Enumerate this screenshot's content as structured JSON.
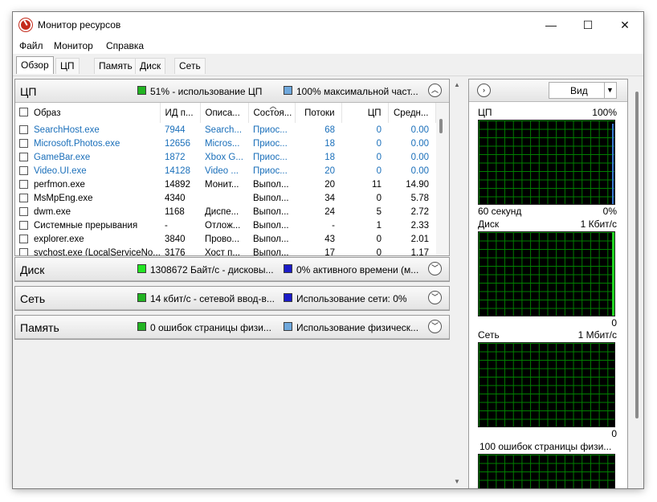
{
  "window": {
    "title": "Монитор ресурсов",
    "icon": "resmon-icon",
    "controls": {
      "minimize": "—",
      "maximize": "☐",
      "close": "✕"
    }
  },
  "menu": [
    "Файл",
    "Монитор",
    "Справка"
  ],
  "tabs": [
    {
      "label": "Обзор",
      "active": true
    },
    {
      "label": "ЦП"
    },
    {
      "label": "Память"
    },
    {
      "label": "Диск"
    },
    {
      "label": "Сеть"
    }
  ],
  "cpu": {
    "title": "ЦП",
    "legend1": {
      "color": "#22b422",
      "text": "51% - использование ЦП"
    },
    "legend2": {
      "color": "#6fa8dc",
      "text": "100% максимальной част..."
    },
    "columns": [
      "Образ",
      "ИД п...",
      "Описа...",
      "Состоя...",
      "Потоки",
      "ЦП",
      "Средн..."
    ],
    "rows": [
      {
        "name": "SearchHost.exe",
        "pid": "7944",
        "desc": "Search...",
        "status": "Приос...",
        "threads": "68",
        "cpu": "0",
        "avg": "0.00",
        "suspended": true
      },
      {
        "name": "Microsoft.Photos.exe",
        "pid": "12656",
        "desc": "Micros...",
        "status": "Приос...",
        "threads": "18",
        "cpu": "0",
        "avg": "0.00",
        "suspended": true
      },
      {
        "name": "GameBar.exe",
        "pid": "1872",
        "desc": "Xbox G...",
        "status": "Приос...",
        "threads": "18",
        "cpu": "0",
        "avg": "0.00",
        "suspended": true
      },
      {
        "name": "Video.UI.exe",
        "pid": "14128",
        "desc": "Video ...",
        "status": "Приос...",
        "threads": "20",
        "cpu": "0",
        "avg": "0.00",
        "suspended": true
      },
      {
        "name": "perfmon.exe",
        "pid": "14892",
        "desc": "Монит...",
        "status": "Выпол...",
        "threads": "20",
        "cpu": "11",
        "avg": "14.90",
        "suspended": false
      },
      {
        "name": "MsMpEng.exe",
        "pid": "4340",
        "desc": "",
        "status": "Выпол...",
        "threads": "34",
        "cpu": "0",
        "avg": "5.78",
        "suspended": false
      },
      {
        "name": "dwm.exe",
        "pid": "1168",
        "desc": "Диспе...",
        "status": "Выпол...",
        "threads": "24",
        "cpu": "5",
        "avg": "2.72",
        "suspended": false
      },
      {
        "name": "Системные прерывания",
        "pid": "-",
        "desc": "Отлож...",
        "status": "Выпол...",
        "threads": "-",
        "cpu": "1",
        "avg": "2.33",
        "suspended": false
      },
      {
        "name": "explorer.exe",
        "pid": "3840",
        "desc": "Прово...",
        "status": "Выпол...",
        "threads": "43",
        "cpu": "0",
        "avg": "2.01",
        "suspended": false
      },
      {
        "name": "svchost.exe (LocalServiceNo...",
        "pid": "3176",
        "desc": "Хост п...",
        "status": "Выпол...",
        "threads": "17",
        "cpu": "0",
        "avg": "1.17",
        "suspended": false
      }
    ]
  },
  "disk": {
    "title": "Диск",
    "legend1": {
      "color": "#22e622",
      "text": "1308672 Байт/с - дисковы..."
    },
    "legend2": {
      "color": "#1c1cc8",
      "text": "0% активного времени (м..."
    }
  },
  "network": {
    "title": "Сеть",
    "legend1": {
      "color": "#22b422",
      "text": "14 кбит/с - сетевой ввод-в..."
    },
    "legend2": {
      "color": "#1c1cc8",
      "text": "Использование сети: 0%"
    }
  },
  "memory": {
    "title": "Память",
    "legend1": {
      "color": "#22b422",
      "text": "0 ошибок страницы физи..."
    },
    "legend2": {
      "color": "#6fa8dc",
      "text": "Использование физическ..."
    }
  },
  "graphs": {
    "view_label": "Вид",
    "cpu": {
      "label": "ЦП",
      "max": "100%",
      "time": "60 секунд",
      "min": "0%"
    },
    "disk": {
      "label": "Диск",
      "max": "1 Кбит/с",
      "min": "0"
    },
    "network": {
      "label": "Сеть",
      "max": "1 Мбит/с",
      "min": "0"
    },
    "memory": {
      "label": "100 ошибок страницы физи..."
    }
  }
}
